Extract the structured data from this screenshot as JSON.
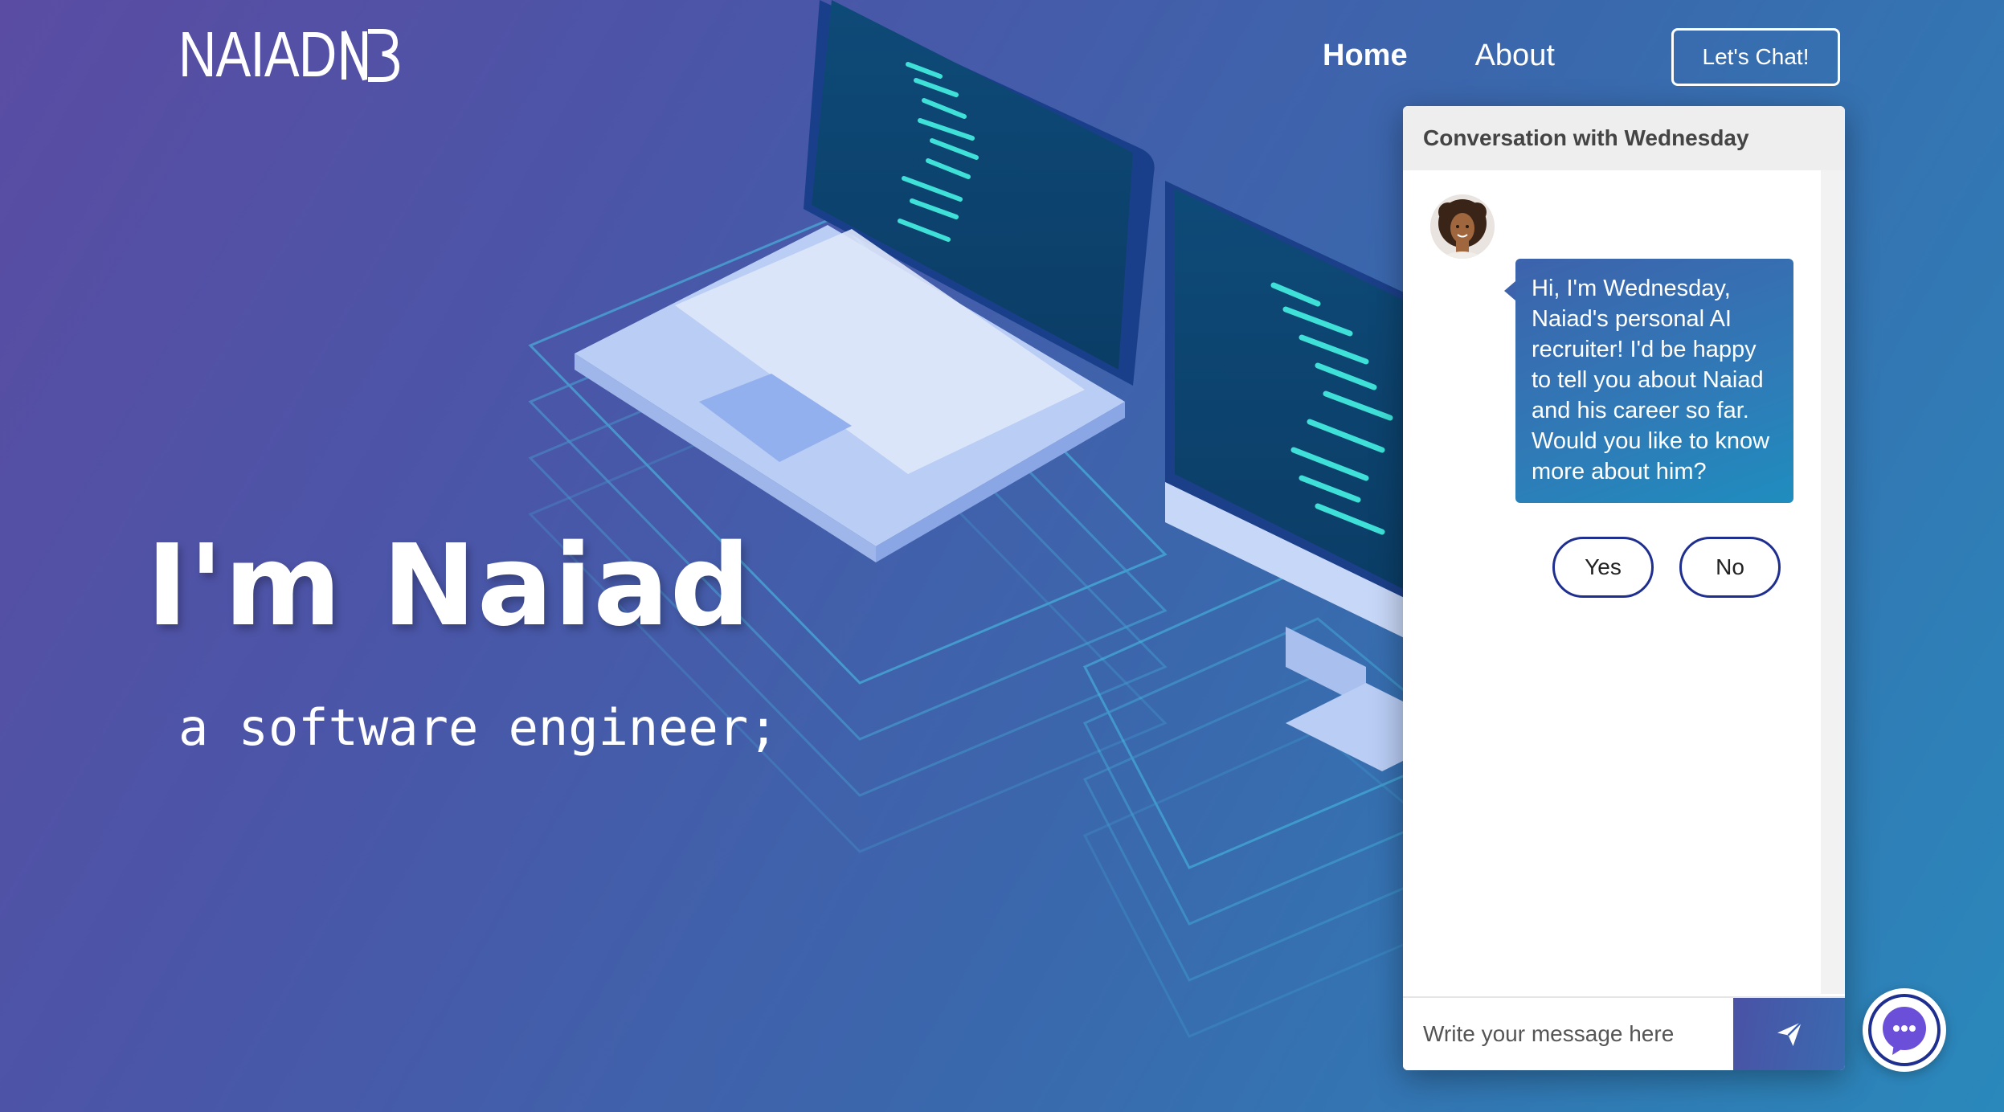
{
  "brand": {
    "name": "NAIAD",
    "monogram": "NB"
  },
  "nav": {
    "items": [
      {
        "label": "Home",
        "active": true
      },
      {
        "label": "About",
        "active": false
      }
    ],
    "cta_label": "Let's Chat!"
  },
  "hero": {
    "title": "I'm Naiad",
    "subtitle": "a software engineer;"
  },
  "chat": {
    "header": "Conversation with Wednesday",
    "messages": [
      {
        "sender": "Wednesday",
        "text": "Hi, I'm Wednesday, Naiad's personal AI recruiter! I'd be happy to tell you about Naiad and his career so far. Would you like to know more about him?"
      }
    ],
    "quick_replies": [
      "Yes",
      "No"
    ],
    "input_placeholder": "Write your message here",
    "send_icon": "paper-plane-icon",
    "launcher_icon": "chat-bubble-icon"
  },
  "colors": {
    "background_start": "#5a4ca3",
    "background_end": "#2a88bb",
    "accent_navy": "#1f2f8f",
    "bubble": "#2f7bb7",
    "launcher": "#6c4fd8"
  }
}
